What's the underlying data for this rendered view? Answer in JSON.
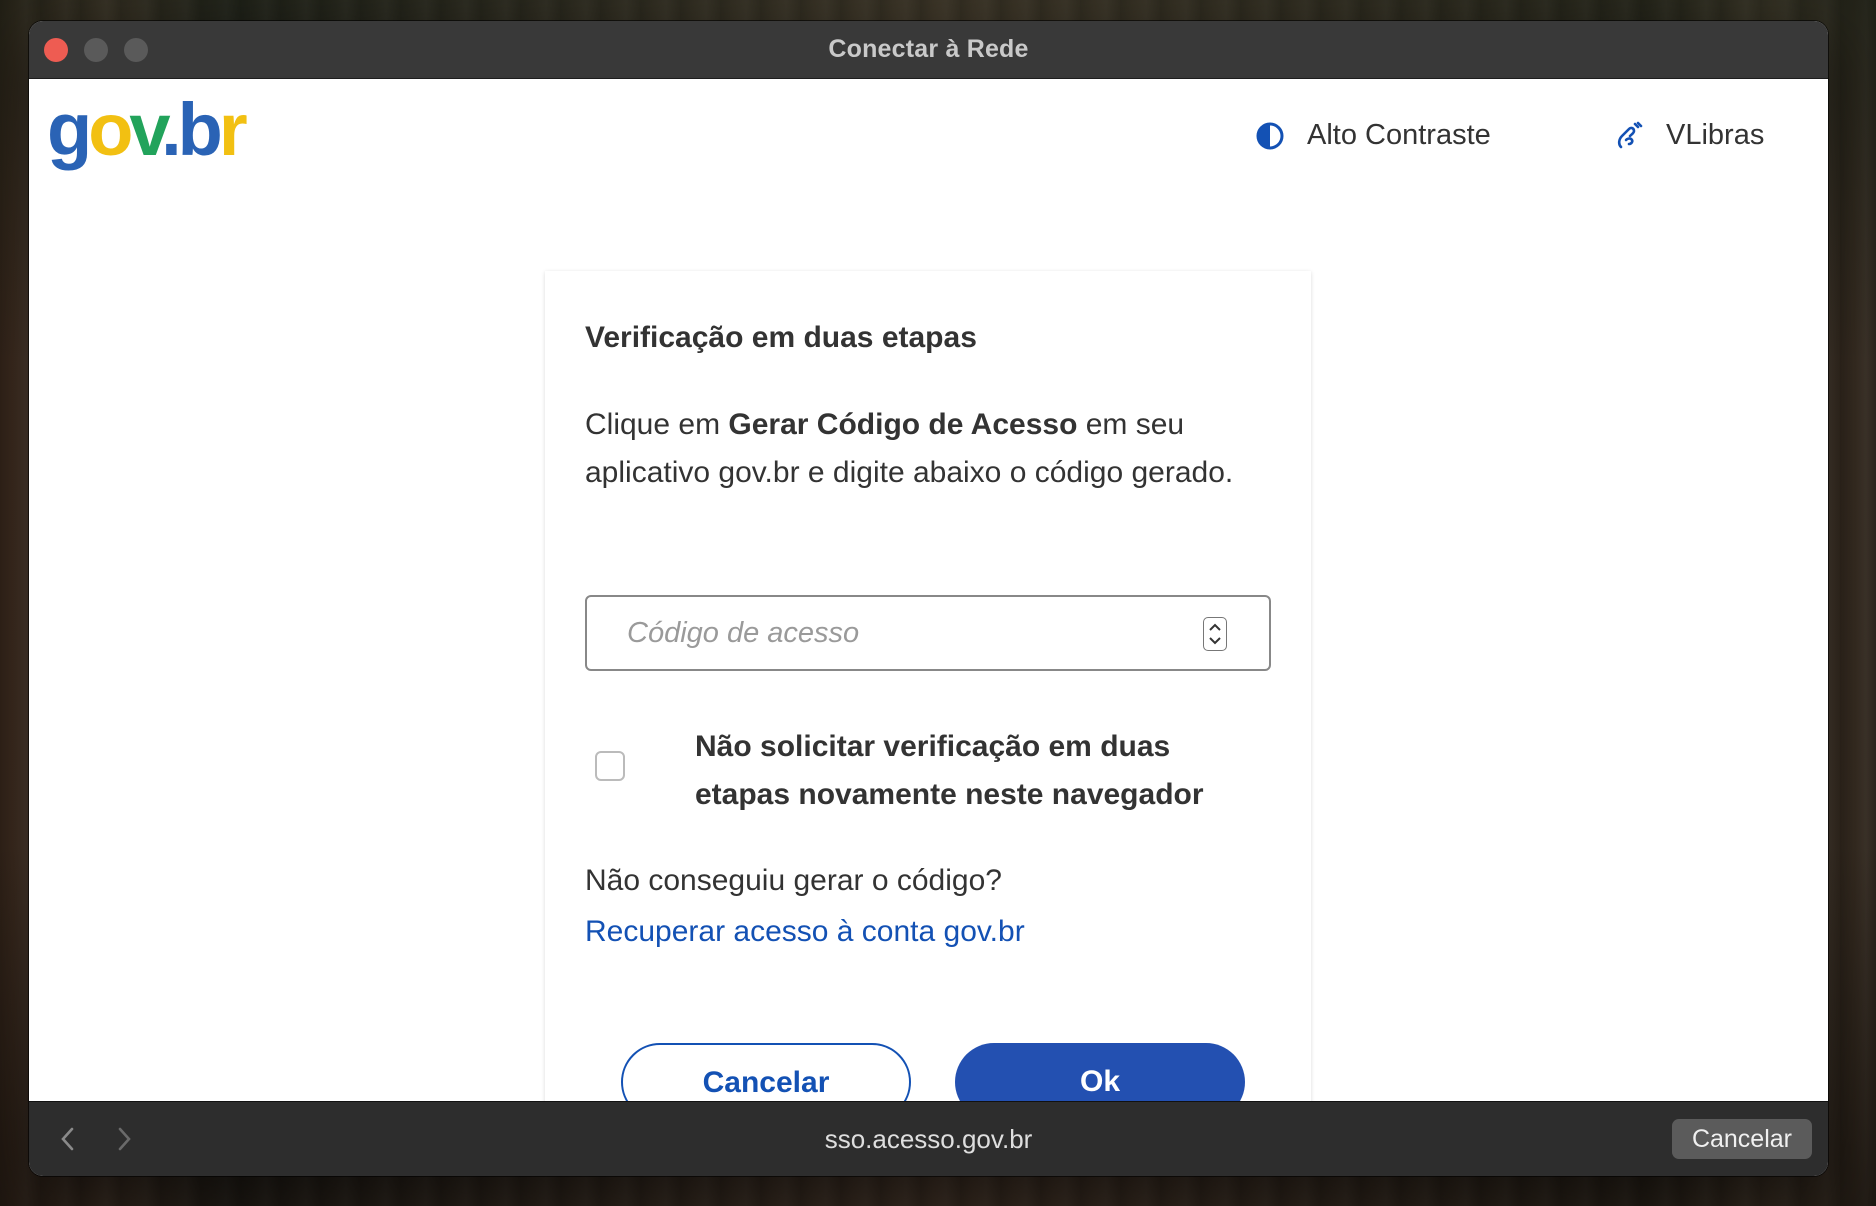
{
  "window": {
    "title": "Conectar à Rede"
  },
  "header": {
    "logo": {
      "g": "g",
      "o": "o",
      "v": "v",
      "dot": ".",
      "b": "b",
      "r": "r"
    },
    "contrast_label": "Alto Contraste",
    "libras_label": "VLibras"
  },
  "card": {
    "title": "Verificação em duas etapas",
    "instruction_prefix": "Clique em ",
    "instruction_bold": "Gerar Código de Acesso",
    "instruction_suffix": " em seu aplicativo gov.br e digite abaixo o código gerado.",
    "code_placeholder": "Código de acesso",
    "code_value": "",
    "remember_label": "Não solicitar verificação em duas etapas novamente neste navegador",
    "remember_checked": false,
    "help_text": "Não conseguiu gerar o código?",
    "recover_link": "Recuperar acesso à conta gov.br",
    "cancel_label": "Cancelar",
    "ok_label": "Ok"
  },
  "bottom_bar": {
    "url": "sso.acesso.gov.br",
    "cancel_label": "Cancelar"
  },
  "icons": {
    "contrast": "contrast-icon",
    "libras": "hand-sign-icon",
    "back": "chevron-left-icon",
    "forward": "chevron-right-icon"
  },
  "colors": {
    "brand_blue": "#1351b4",
    "ok_button": "#2350b1",
    "logo_blue": "#2a63b5",
    "logo_yellow": "#f2c012",
    "logo_green": "#22a35b",
    "close_button": "#ee5c52"
  }
}
